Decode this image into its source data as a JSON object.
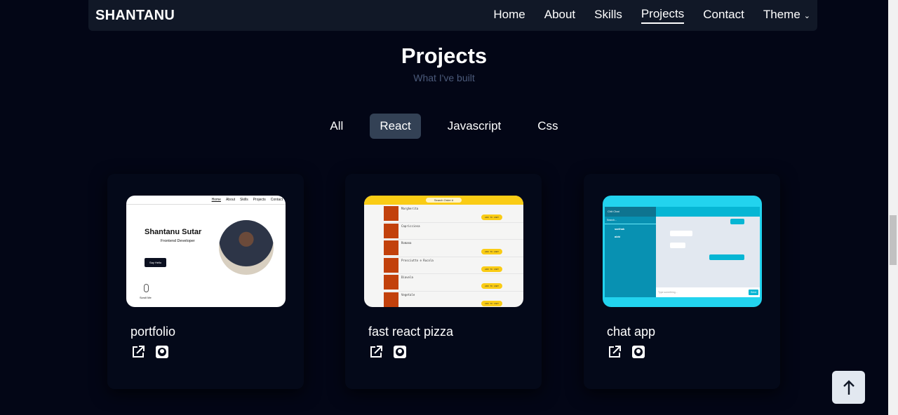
{
  "nav": {
    "logo": "SHANTANU",
    "links": [
      "Home",
      "About",
      "Skills",
      "Projects",
      "Contact",
      "Theme"
    ],
    "active": "Projects"
  },
  "section": {
    "title": "Projects",
    "subtitle": "What I've built"
  },
  "filters": {
    "items": [
      "All",
      "React",
      "Javascript",
      "Css"
    ],
    "selected": "React"
  },
  "projects": [
    {
      "name": "portfolio",
      "preview": {
        "nav": [
          "Home",
          "About",
          "Skills",
          "Projects",
          "Contact"
        ],
        "heading": "Shantanu Sutar",
        "role": "Frontend Developer",
        "button": "Say Hello",
        "scroll": "Scroll Me"
      }
    },
    {
      "name": "fast react pizza",
      "preview": {
        "search": "Search Order #",
        "items": [
          "Margherita",
          "Capricciosa",
          "Romana",
          "Prosciutto e Rucola",
          "Diavola",
          "Vegetale"
        ],
        "button": "ADD TO CART"
      }
    },
    {
      "name": "chat app",
      "preview": {
        "app": "Chit Chat",
        "search": "Search...",
        "contacts": [
          "sarthak",
          "abhi"
        ],
        "input": "Type something...",
        "send": "Send"
      }
    }
  ],
  "icons": {
    "link": "external-link-icon",
    "repo": "github-icon",
    "top": "arrow-up-icon"
  },
  "colors": {
    "background": "#030616",
    "nav": "#111827",
    "selected_filter": "#334155",
    "pizza": "#facc15",
    "chat": "#22d3ee"
  }
}
